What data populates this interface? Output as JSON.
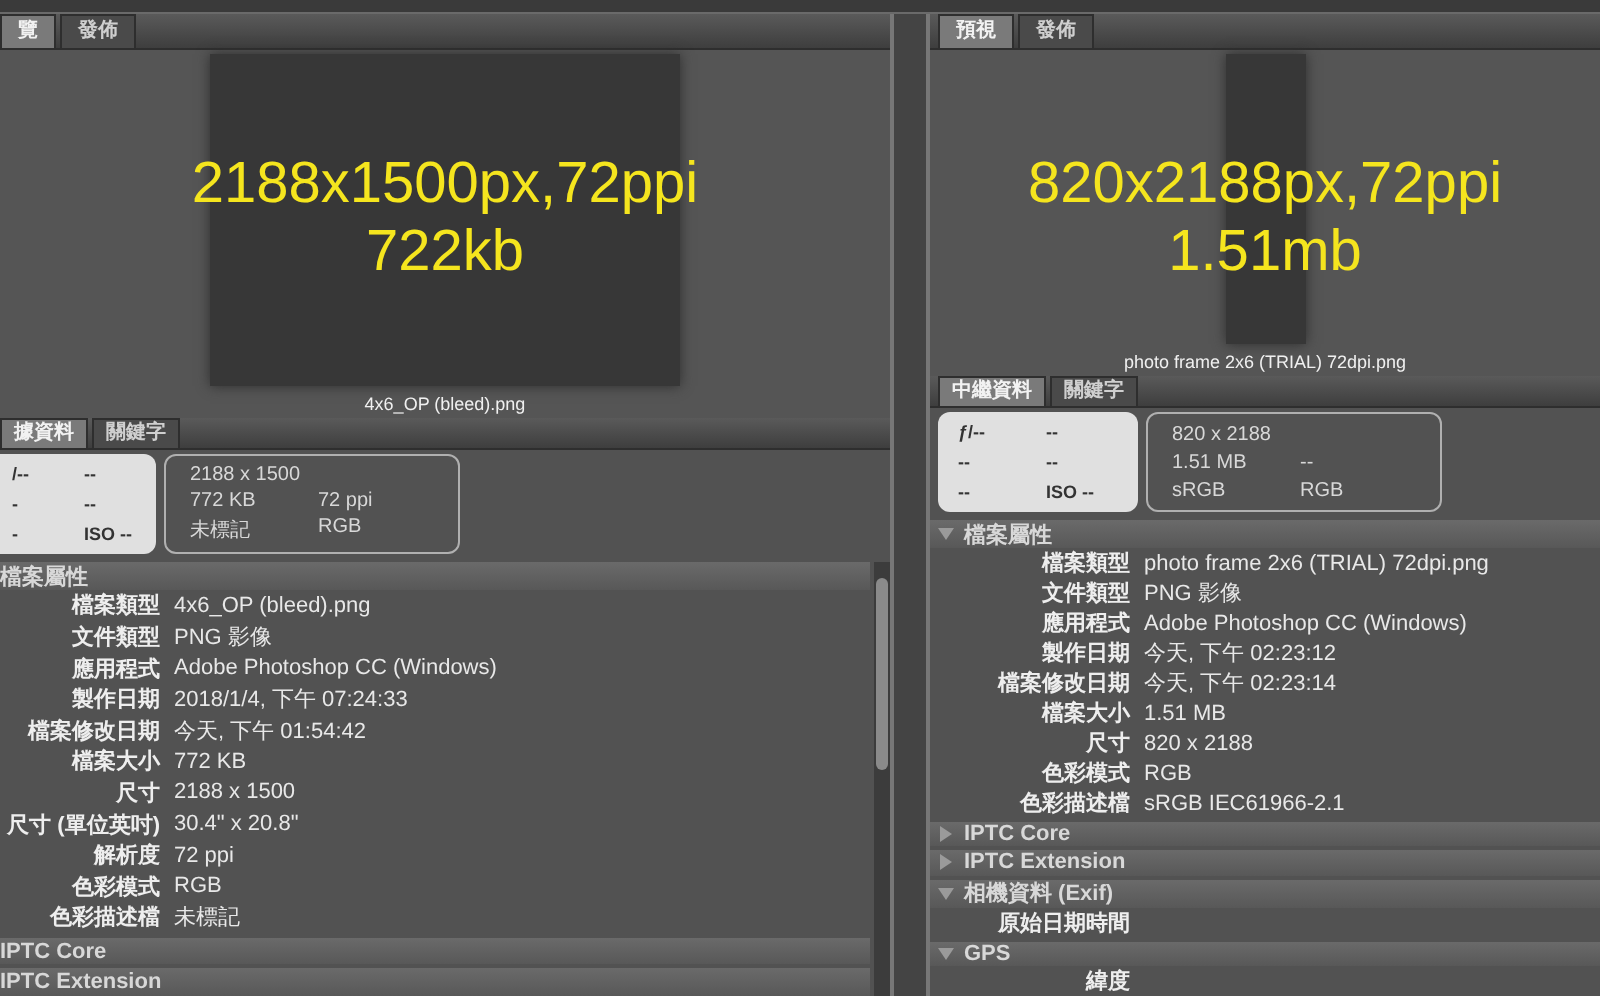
{
  "panels": [
    {
      "tabs": [
        {
          "label": "覽",
          "selected": true
        },
        {
          "label": "發佈",
          "selected": false
        }
      ],
      "preview": {
        "overlay_lines": [
          "2188x1500px,72ppi",
          "722kb"
        ],
        "filename": "4x6_OP (bleed).png"
      },
      "meta_tabs": [
        {
          "label": "據資料",
          "selected": true
        },
        {
          "label": "關鍵字",
          "selected": false
        }
      ],
      "camera": [
        "/--",
        "--",
        "-",
        "--",
        "-",
        "ISO --"
      ],
      "summary": [
        [
          "2188 x 1500"
        ],
        [
          "772 KB",
          "72 ppi"
        ],
        [
          "未標記",
          "RGB"
        ]
      ],
      "sections": [
        {
          "title": "檔案屬性",
          "rows": [
            {
              "label": "檔案類型",
              "value": "4x6_OP (bleed).png"
            },
            {
              "label": "文件類型",
              "value": "PNG 影像"
            },
            {
              "label": "應用程式",
              "value": "Adobe Photoshop CC (Windows)"
            },
            {
              "label": "製作日期",
              "value": "2018/1/4, 下午 07:24:33"
            },
            {
              "label": "檔案修改日期",
              "value": "今天, 下午 01:54:42"
            },
            {
              "label": "檔案大小",
              "value": "772 KB"
            },
            {
              "label": "尺寸",
              "value": "2188 x 1500"
            },
            {
              "label": "尺寸 (單位英吋)",
              "value": "30.4\" x 20.8\""
            },
            {
              "label": "解析度",
              "value": "72 ppi"
            },
            {
              "label": "色彩模式",
              "value": "RGB"
            },
            {
              "label": "色彩描述檔",
              "value": "未標記"
            }
          ]
        },
        {
          "title": "IPTC Core"
        },
        {
          "title": "IPTC Extension"
        }
      ]
    },
    {
      "tabs": [
        {
          "label": "預視",
          "selected": true
        },
        {
          "label": "發佈",
          "selected": false
        }
      ],
      "preview": {
        "overlay_lines": [
          "820x2188px,72ppi",
          "1.51mb"
        ],
        "filename": "photo frame 2x6 (TRIAL) 72dpi.png"
      },
      "meta_tabs": [
        {
          "label": "中繼資料",
          "selected": true
        },
        {
          "label": "關鍵字",
          "selected": false
        }
      ],
      "camera": [
        "ƒ/--",
        "--",
        "--",
        "--",
        "--",
        "ISO --"
      ],
      "summary": [
        [
          "820 x 2188"
        ],
        [
          "1.51 MB",
          "--"
        ],
        [
          "sRGB",
          "RGB"
        ]
      ],
      "sections": [
        {
          "title": "檔案屬性",
          "expanded": true,
          "rows": [
            {
              "label": "檔案類型",
              "value": "photo frame 2x6 (TRIAL) 72dpi.png"
            },
            {
              "label": "文件類型",
              "value": "PNG 影像"
            },
            {
              "label": "應用程式",
              "value": "Adobe Photoshop CC (Windows)"
            },
            {
              "label": "製作日期",
              "value": "今天, 下午 02:23:12"
            },
            {
              "label": "檔案修改日期",
              "value": "今天, 下午 02:23:14"
            },
            {
              "label": "檔案大小",
              "value": "1.51 MB"
            },
            {
              "label": "尺寸",
              "value": "820 x 2188"
            },
            {
              "label": "色彩模式",
              "value": "RGB"
            },
            {
              "label": "色彩描述檔",
              "value": "sRGB IEC61966-2.1"
            }
          ]
        },
        {
          "title": "IPTC Core",
          "expanded": false
        },
        {
          "title": "IPTC Extension",
          "expanded": false
        },
        {
          "title": "相機資料 (Exif)",
          "expanded": true,
          "rows": [
            {
              "label": "原始日期時間"
            }
          ]
        },
        {
          "title": "GPS",
          "expanded": true,
          "rows": [
            {
              "label": "緯度"
            }
          ]
        }
      ]
    }
  ]
}
